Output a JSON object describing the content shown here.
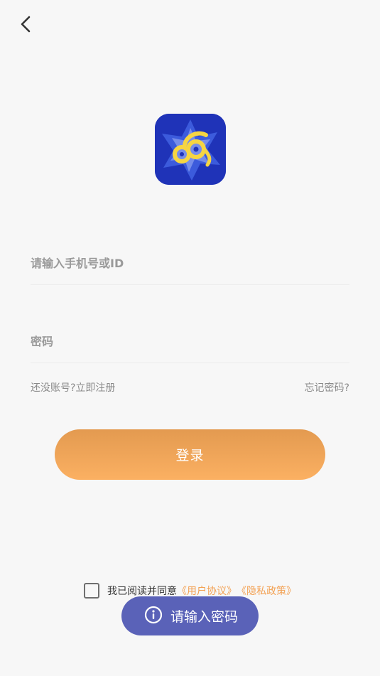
{
  "header": {
    "back_icon": "chevron-left-icon"
  },
  "logo": {
    "icon": "app-logo-icon",
    "colors": {
      "background": "#1f33b8",
      "accent": "#f6d542"
    }
  },
  "form": {
    "phone_placeholder": "请输入手机号或ID",
    "password_placeholder": "密码",
    "register_link": "还没账号?立即注册",
    "forgot_link": "忘记密码?",
    "login_label": "登录"
  },
  "agreement": {
    "checked": false,
    "text": "我已阅读并同意",
    "user_agreement": "《用户协议》",
    "privacy_policy": "《隐私政策》"
  },
  "toast": {
    "icon": "info-icon",
    "message": "请输入密码"
  },
  "colors": {
    "accent": "#f3a153",
    "toast_bg": "#5a62b8",
    "page_bg": "#f7f7f7"
  }
}
